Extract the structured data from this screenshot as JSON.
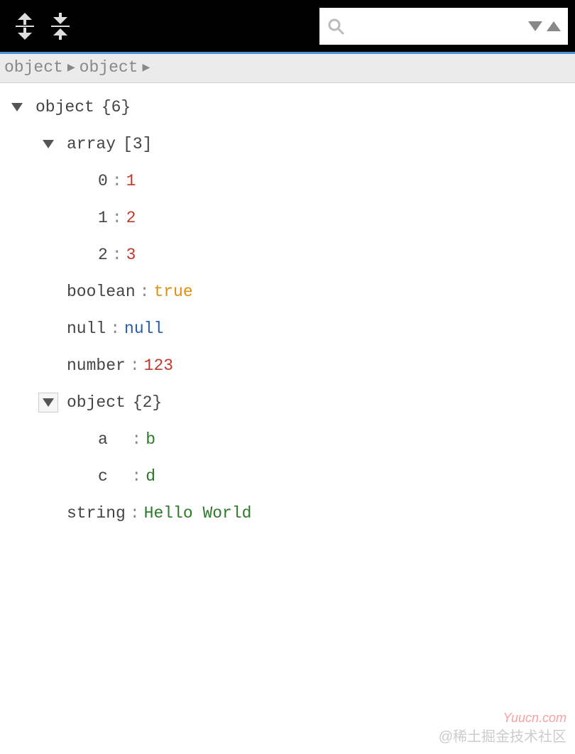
{
  "toolbar": {
    "expand_all_title": "Expand all",
    "collapse_all_title": "Collapse all",
    "search_placeholder": "",
    "nav_prev_title": "Previous",
    "nav_next_title": "Next"
  },
  "breadcrumb": {
    "items": [
      "object",
      "object"
    ]
  },
  "tree": {
    "root": {
      "key": "object",
      "meta": "{6}"
    },
    "nodes": [
      {
        "key": "array",
        "meta": "[3]",
        "expanded": true,
        "children": [
          {
            "key": "0",
            "value": "1",
            "vtype": "num"
          },
          {
            "key": "1",
            "value": "2",
            "vtype": "num"
          },
          {
            "key": "2",
            "value": "3",
            "vtype": "num"
          }
        ]
      },
      {
        "key": "boolean",
        "value": "true",
        "vtype": "bool"
      },
      {
        "key": "null",
        "value": "null",
        "vtype": "null"
      },
      {
        "key": "number",
        "value": "123",
        "vtype": "num"
      },
      {
        "key": "object",
        "meta": "{2}",
        "expanded": true,
        "boxed": true,
        "children": [
          {
            "key": "a",
            "value": "b",
            "vtype": "str",
            "pad": 3
          },
          {
            "key": "c",
            "value": "d",
            "vtype": "str",
            "pad": 3
          }
        ]
      },
      {
        "key": "string",
        "value": "Hello World",
        "vtype": "str"
      }
    ]
  },
  "watermarks": {
    "w1": "Yuucn.com",
    "w2": "@稀土掘金技术社区"
  },
  "icons": {
    "search": "search-icon",
    "down": "triangle-down-icon",
    "up": "triangle-up-icon"
  }
}
